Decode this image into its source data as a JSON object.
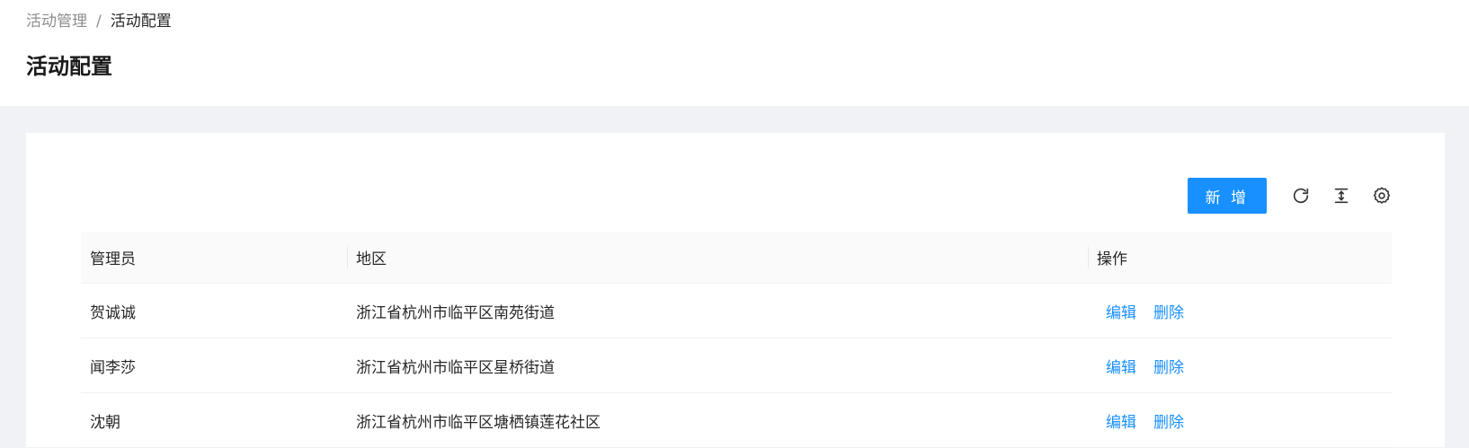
{
  "breadcrumb": {
    "parent": "活动管理",
    "separator": "/",
    "current": "活动配置"
  },
  "page": {
    "title": "活动配置"
  },
  "toolbar": {
    "add_label": "新 增",
    "icons": [
      "refresh-icon",
      "density-icon",
      "settings-icon"
    ]
  },
  "table": {
    "columns": [
      "管理员",
      "地区",
      "操作"
    ],
    "rows": [
      {
        "admin": "贺诚诚",
        "region": "浙江省杭州市临平区南苑街道",
        "edit": "编辑",
        "delete": "删除"
      },
      {
        "admin": "闻李莎",
        "region": "浙江省杭州市临平区星桥街道",
        "edit": "编辑",
        "delete": "删除"
      },
      {
        "admin": "沈朝",
        "region": "浙江省杭州市临平区塘栖镇莲花社区",
        "edit": "编辑",
        "delete": "删除"
      }
    ]
  },
  "colors": {
    "primary": "#1890ff",
    "page_bg": "#f0f2f5",
    "header_bg": "#fafafa"
  }
}
